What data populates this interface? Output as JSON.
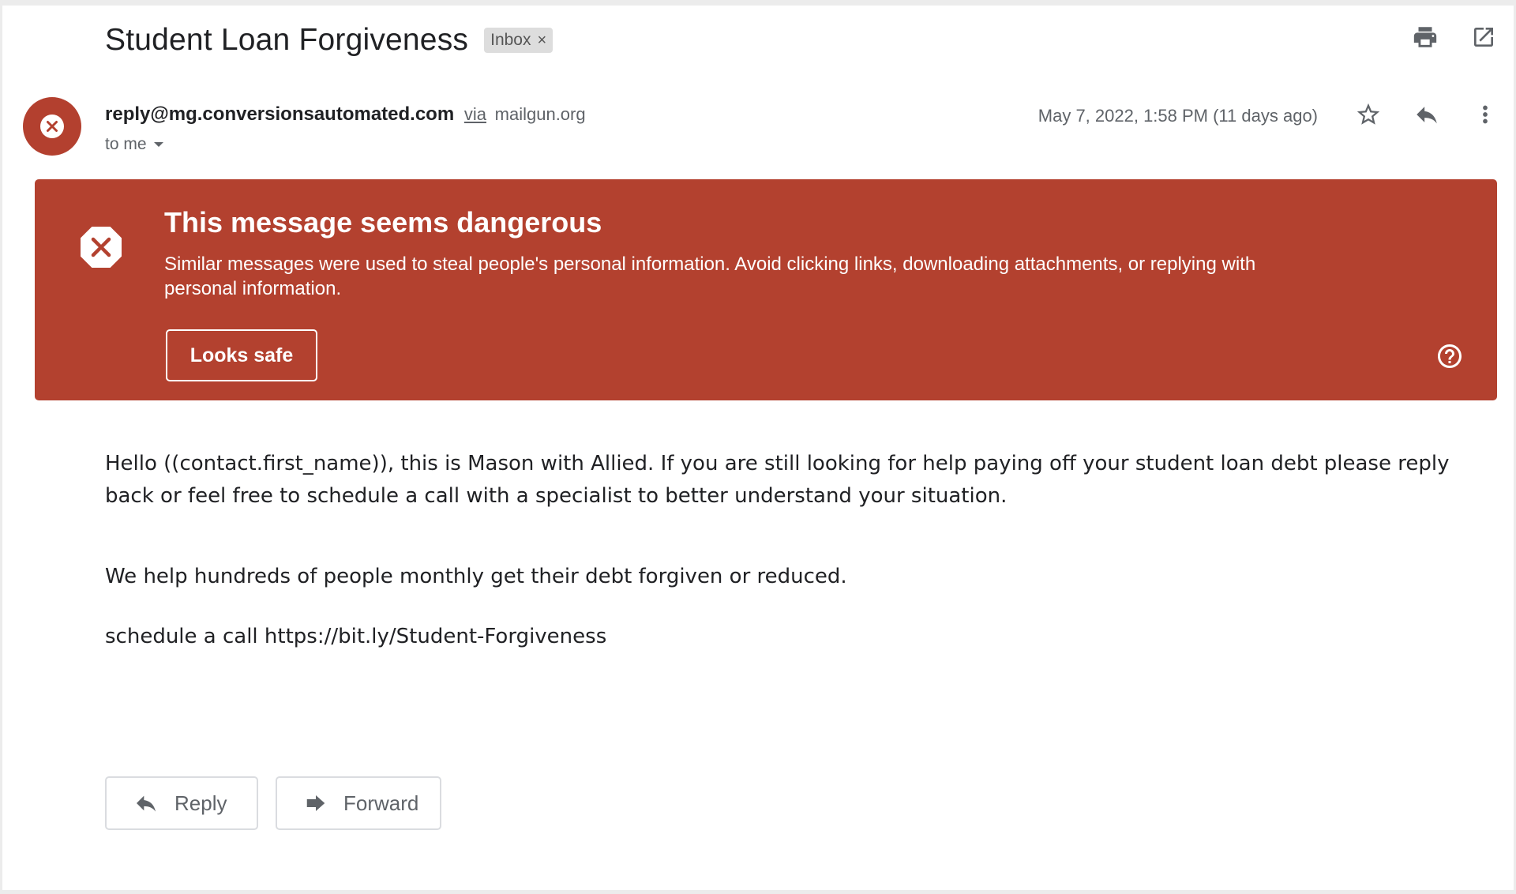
{
  "subject": {
    "title": "Student Loan Forgiveness",
    "label": "Inbox",
    "label_remove": "×"
  },
  "header_icons": [
    "print-icon",
    "open-in-new-window-icon"
  ],
  "sender": {
    "email": "reply@mg.conversionsautomated.com",
    "via": "via",
    "via_domain": "mailgun.org",
    "to": "to me",
    "avatar_icon": "danger-x-icon"
  },
  "message_meta": {
    "date": "May 7, 2022, 1:58 PM (11 days ago)",
    "icons": [
      "star-icon",
      "reply-icon",
      "more-vert-icon"
    ]
  },
  "warning": {
    "title": "This message seems dangerous",
    "text": "Similar messages were used to steal people's personal information. Avoid clicking links, downloading attachments, or replying with personal information.",
    "button_label": "Looks safe",
    "icon": "danger-x-icon",
    "help_icon": "help-circle-icon",
    "color": "#b3412f"
  },
  "body": {
    "paragraph1": "Hello ((contact.first_name)), this is Mason with Allied. If you are still looking for help paying off your student loan debt please reply back or feel free to schedule a call with a specialist to better understand your situation.",
    "paragraph2": "We help hundreds of people monthly get their debt forgiven or reduced.",
    "paragraph3": "schedule a call https://bit.ly/Student-Forgiveness"
  },
  "actions": {
    "reply_label": "Reply",
    "forward_label": "Forward"
  }
}
